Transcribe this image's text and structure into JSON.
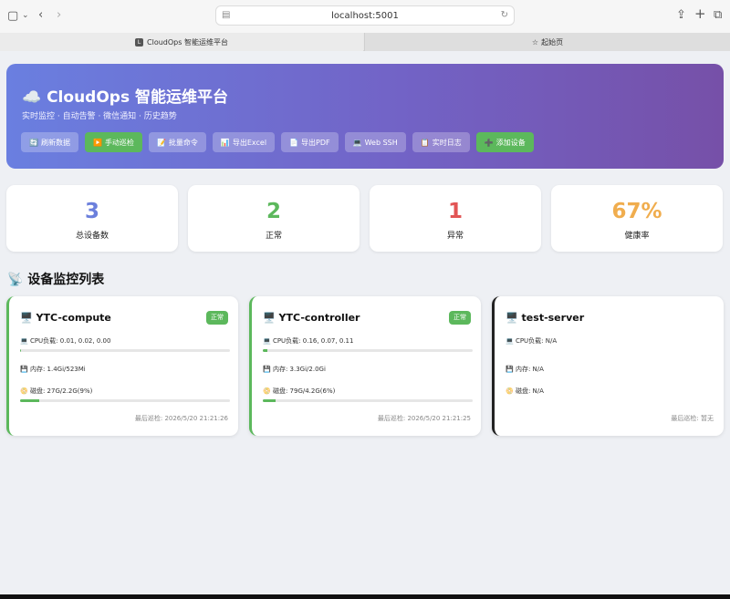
{
  "browser": {
    "url": "localhost:5001",
    "tabs": [
      {
        "label": "CloudOps 智能运维平台",
        "active": true,
        "favicon": "L"
      },
      {
        "label": "起始页",
        "active": false
      }
    ]
  },
  "header": {
    "title": "☁️ CloudOps 智能运维平台",
    "subtitle": "实时监控 · 自动告警 · 微信通知 · 历史趋势",
    "buttons": [
      {
        "icon": "🔄",
        "label": "刷新数据",
        "style": "default"
      },
      {
        "icon": "▶️",
        "label": "手动巡检",
        "style": "green"
      },
      {
        "icon": "📝",
        "label": "批量命令",
        "style": "default"
      },
      {
        "icon": "📊",
        "label": "导出Excel",
        "style": "default"
      },
      {
        "icon": "📄",
        "label": "导出PDF",
        "style": "default"
      },
      {
        "icon": "💻",
        "label": "Web SSH",
        "style": "default"
      },
      {
        "icon": "📋",
        "label": "实时日志",
        "style": "default"
      },
      {
        "icon": "➕",
        "label": "添加设备",
        "style": "green"
      }
    ]
  },
  "stats": [
    {
      "value": "3",
      "label": "总设备数",
      "color": "#6b7fdc"
    },
    {
      "value": "2",
      "label": "正常",
      "color": "#5cb85c"
    },
    {
      "value": "1",
      "label": "异常",
      "color": "#e25555"
    },
    {
      "value": "67%",
      "label": "健康率",
      "color": "#f0ad4e"
    }
  ],
  "section_title": "📡 设备监控列表",
  "devices": [
    {
      "name": "YTC-compute",
      "icon": "🖥️",
      "status": "正常",
      "state": "ok",
      "cpu": "CPU负载: 0.01, 0.02, 0.00",
      "cpu_fill": 0.0,
      "mem": "内存: 1.4Gi/523Mi",
      "disk": "磁盘: 27G/2.2G(9%)",
      "disk_fill": 0.09,
      "last": "最后巡检: 2026/5/20 21:21:26"
    },
    {
      "name": "YTC-controller",
      "icon": "🖥️",
      "status": "正常",
      "state": "ok",
      "cpu": "CPU负载: 0.16, 0.07, 0.11",
      "cpu_fill": 0.02,
      "mem": "内存: 3.3Gi/2.0Gi",
      "disk": "磁盘: 79G/4.2G(6%)",
      "disk_fill": 0.06,
      "last": "最后巡检: 2026/5/20 21:21:25"
    },
    {
      "name": "test-server",
      "icon": "🖥️",
      "status": "",
      "state": "unknown",
      "cpu": "CPU负载: N/A",
      "cpu_fill": null,
      "mem": "内存: N/A",
      "disk": "磁盘: N/A",
      "disk_fill": null,
      "last": "最后巡检: 暂无"
    }
  ],
  "labels": {
    "cpu_icon": "💻",
    "mem_icon": "💾",
    "disk_icon": "📀"
  }
}
